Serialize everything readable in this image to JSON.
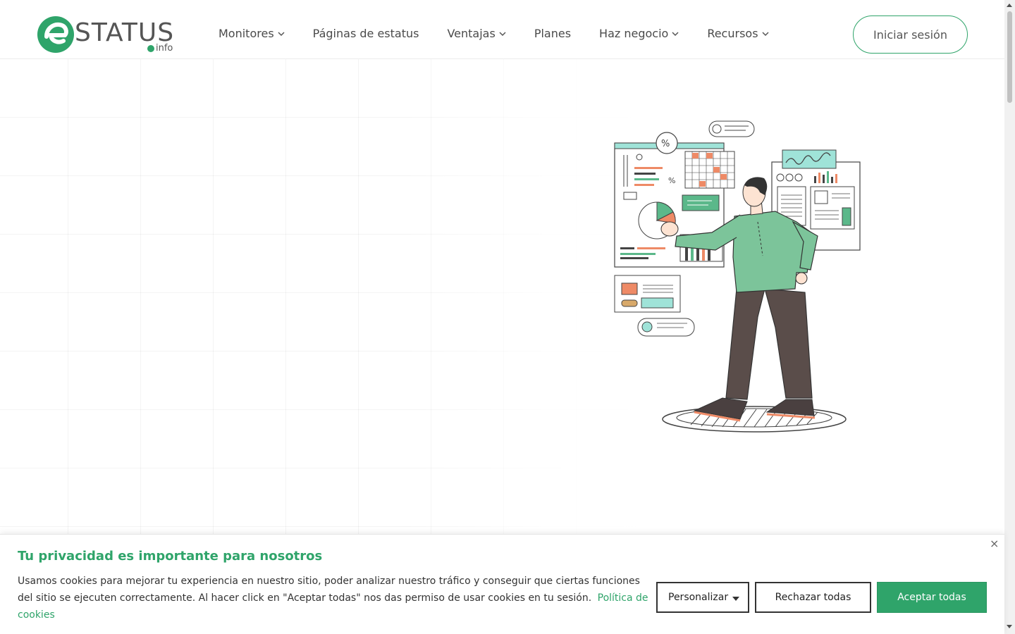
{
  "brand": {
    "logo_text": "STATUS",
    "logo_sub": "info",
    "accent_color": "#2fa46a"
  },
  "nav": {
    "items": [
      {
        "label": "Monitores",
        "has_dropdown": true
      },
      {
        "label": "Páginas de estatus",
        "has_dropdown": false
      },
      {
        "label": "Ventajas",
        "has_dropdown": true
      },
      {
        "label": "Planes",
        "has_dropdown": false
      },
      {
        "label": "Haz negocio",
        "has_dropdown": true
      },
      {
        "label": "Recursos",
        "has_dropdown": true
      }
    ],
    "login_label": "Iniciar sesión"
  },
  "cookie": {
    "title": "Tu privacidad es importante para nosotros",
    "text": "Usamos cookies para mejorar tu experiencia en nuestro sitio, poder analizar nuestro tráfico y conseguir que ciertas funciones del sitio se ejecuten correctamente. Al hacer click en \"Aceptar todas\" nos das permiso de usar cookies en tu sesión.",
    "policy_link": "Política de cookies",
    "close_icon": "×",
    "customize_label": "Personalizar",
    "reject_label": "Rechazar todas",
    "accept_label": "Aceptar todas"
  },
  "icons": [
    "chevron-down-icon",
    "close-icon",
    "logo-e-icon",
    "check-icon"
  ]
}
